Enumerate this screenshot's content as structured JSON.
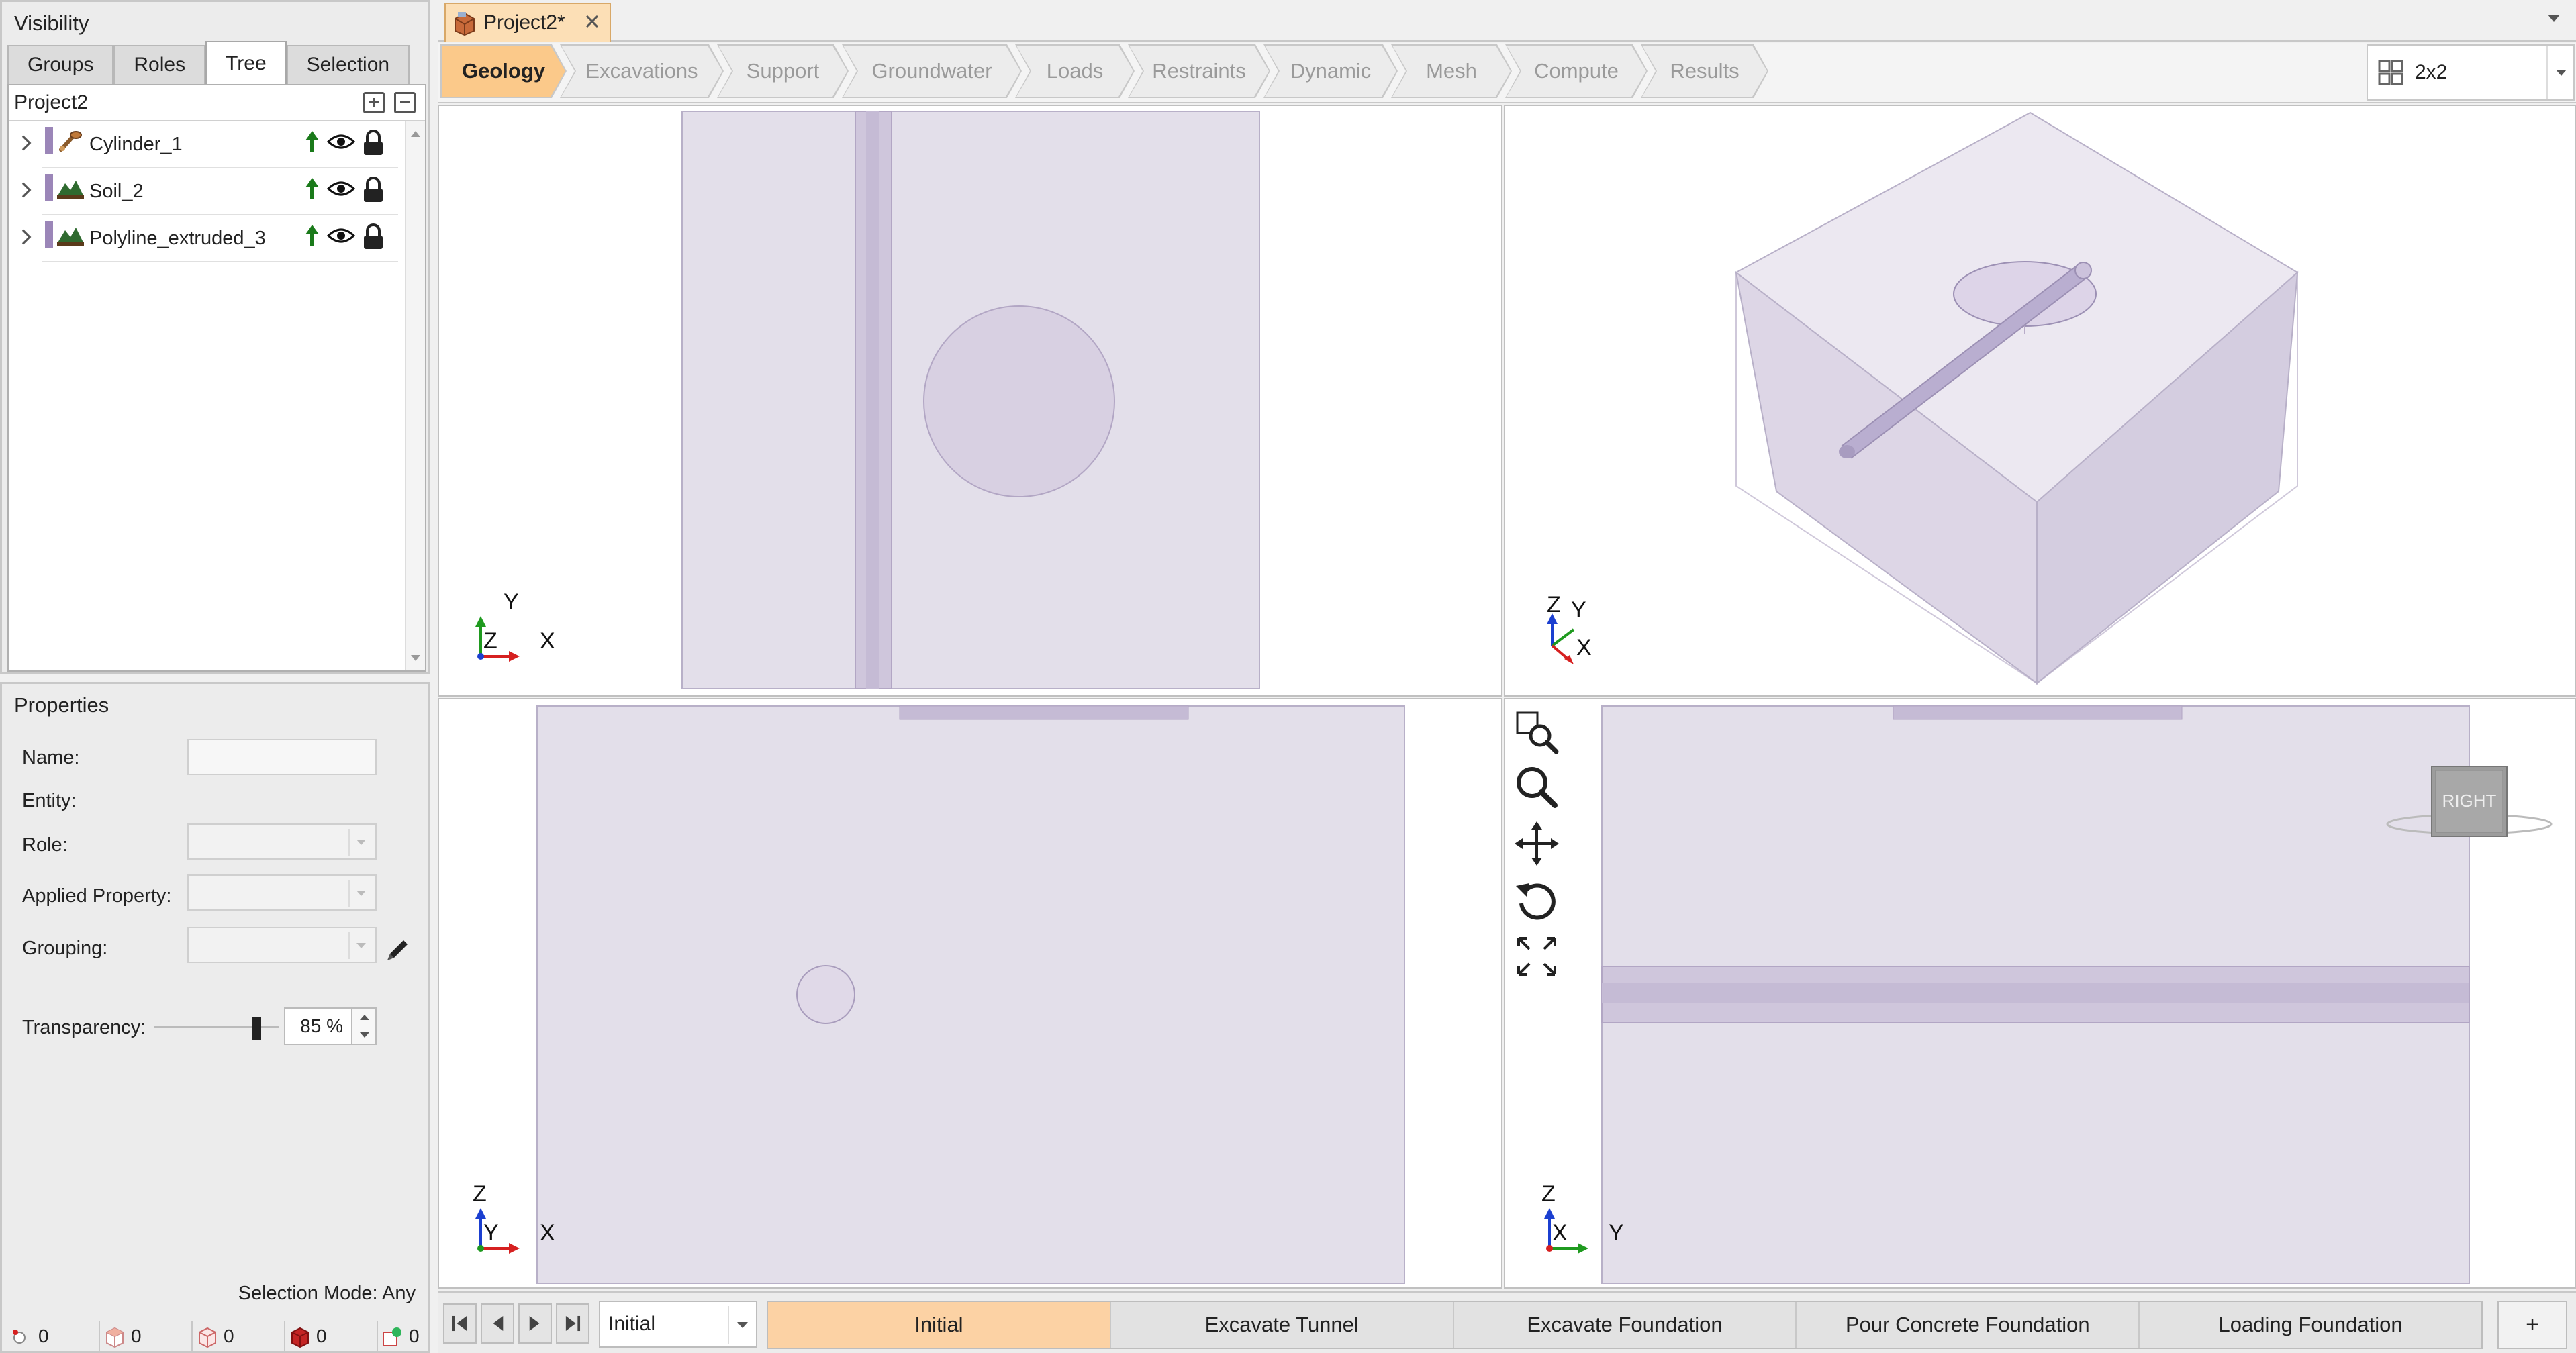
{
  "visibility": {
    "title": "Visibility",
    "tabs": [
      {
        "label": "Groups",
        "active": false
      },
      {
        "label": "Roles",
        "active": false
      },
      {
        "label": "Tree",
        "active": true
      },
      {
        "label": "Selection",
        "active": false
      }
    ],
    "tree_root": "Project2",
    "items": [
      {
        "name": "Cylinder_1",
        "type_icon": "cylinder-icon",
        "color": "#9b86b8"
      },
      {
        "name": "Soil_2",
        "type_icon": "soil-icon",
        "color": "#9b86b8"
      },
      {
        "name": "Polyline_extruded_3",
        "type_icon": "soil-icon",
        "color": "#9b86b8"
      }
    ]
  },
  "properties": {
    "title": "Properties",
    "name_label": "Name:",
    "entity_label": "Entity:",
    "role_label": "Role:",
    "applied_property_label": "Applied Property:",
    "grouping_label": "Grouping:",
    "transparency_label": "Transparency:",
    "transparency_value": "85 %",
    "transparency_fraction": 0.85,
    "selection_mode": "Selection Mode: Any",
    "counts": [
      {
        "icon": "node-icon",
        "value": "0"
      },
      {
        "icon": "face-icon",
        "value": "0"
      },
      {
        "icon": "block-outline-icon",
        "value": "0"
      },
      {
        "icon": "solid-block-icon",
        "value": "0"
      },
      {
        "icon": "group-icon",
        "value": "0"
      }
    ]
  },
  "document": {
    "tab_label": "Project2*"
  },
  "workflow": {
    "steps": [
      {
        "label": "Geology",
        "active": true
      },
      {
        "label": "Excavations",
        "active": false
      },
      {
        "label": "Support",
        "active": false
      },
      {
        "label": "Groundwater",
        "active": false
      },
      {
        "label": "Loads",
        "active": false
      },
      {
        "label": "Restraints",
        "active": false
      },
      {
        "label": "Dynamic",
        "active": false
      },
      {
        "label": "Mesh",
        "active": false
      },
      {
        "label": "Compute",
        "active": false
      },
      {
        "label": "Results",
        "active": false
      }
    ],
    "layout_label": "2x2"
  },
  "viewports": {
    "top": {
      "axes": [
        "Y",
        "Z",
        "X"
      ]
    },
    "iso": {
      "axes": [
        "Z",
        "Y",
        "X"
      ]
    },
    "front": {
      "axes": [
        "Z",
        "Y",
        "X"
      ]
    },
    "right": {
      "axes": [
        "Z",
        "X",
        "Y"
      ],
      "view_cube_label": "RIGHT"
    }
  },
  "colors": {
    "soil_fill": "#e3dfea",
    "soil_stroke": "#b8b0c8",
    "cylinder_fill": "#cfc6dc",
    "accent": "#fbc98a",
    "axis_x": "#d62020",
    "axis_y": "#1f9a1f",
    "axis_z": "#1b3fd0"
  },
  "phases": {
    "current": "Initial",
    "tabs": [
      {
        "label": "Initial",
        "active": true
      },
      {
        "label": "Excavate Tunnel",
        "active": false
      },
      {
        "label": "Excavate Foundation",
        "active": false
      },
      {
        "label": "Pour Concrete Foundation",
        "active": false
      },
      {
        "label": "Loading Foundation",
        "active": false
      }
    ],
    "add_label": "+"
  }
}
